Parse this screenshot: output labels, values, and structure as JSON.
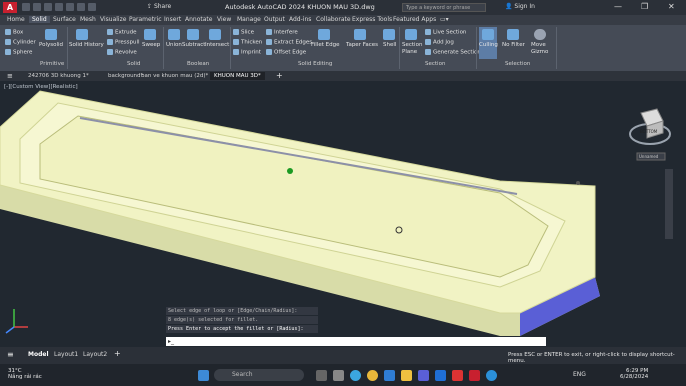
{
  "title_bar": {
    "app_title": "Autodesk AutoCAD 2024   KHUON MAU 3D.dwg",
    "share_label": "Share",
    "search_placeholder": "Type a keyword or phrase",
    "signin_label": "Sign In",
    "logo_letter": "A"
  },
  "ribbon_tabs": [
    "Home",
    "Solid",
    "Surface",
    "Mesh",
    "Visualize",
    "Parametric",
    "Insert",
    "Annotate",
    "View",
    "Manage",
    "Output",
    "Add-ins",
    "Collaborate",
    "Express Tools",
    "Featured Apps"
  ],
  "active_tab": "Solid",
  "ribbon": {
    "primitive": {
      "box": "Box",
      "cylinder": "Cylinder",
      "sphere": "Sphere",
      "polysolid": "Polysolid",
      "label": "Primitive"
    },
    "solid": {
      "solid_history": "Solid History",
      "extrude": "Extrude",
      "presspull": "Presspull",
      "revolve": "Revolve",
      "sweep": "Sweep",
      "label": "Solid"
    },
    "boolean": {
      "union": "Union",
      "subtract": "Subtract",
      "intersect": "Intersect",
      "label": "Boolean"
    },
    "solid_editing": {
      "slice": "Slice",
      "thicken": "Thicken",
      "imprint": "Imprint",
      "interfere": "Interfere",
      "extract_edges": "Extract Edges",
      "offset_edge": "Offset Edge",
      "fillet_edge": "Fillet Edge",
      "taper_faces": "Taper Faces",
      "shell": "Shell",
      "label": "Solid Editing"
    },
    "section": {
      "section_plane": "Section Plane",
      "live_section": "Live Section",
      "add_jog": "Add Jog",
      "generate_section": "Generate Section",
      "label": "Section"
    },
    "selection": {
      "culling": "Culling",
      "no_filter": "No Filter",
      "move_gizmo": "Move Gizmo",
      "label": "Selection"
    }
  },
  "file_tabs": [
    "242706 3D khuong 1*",
    "background*",
    "ban ve khuon mau (2d)*",
    "KHUON MAU 3D*"
  ],
  "active_file": "KHUON MAU 3D*",
  "viewport": {
    "label": "[-][Custom View][Realistic]",
    "viewcube_label": "BOTTOM",
    "ucs_label": "Unnamed"
  },
  "command_history": [
    "Select edge of loop or [Edge/Chain/Radius]:",
    "8 edge(s) selected for fillet.",
    "Press Enter to accept the fillet or [Radius]:"
  ],
  "command_prompt_placeholder": "",
  "layout_tabs": [
    "Model",
    "Layout1",
    "Layout2"
  ],
  "status_message": "Press ESC or ENTER to exit, or right-click to display shortcut-menu.",
  "taskbar": {
    "weather_temp": "31°C",
    "weather_desc": "Nắng rải rác",
    "search_placeholder": "Search",
    "time": "6:29 PM",
    "date": "6/28/2024",
    "lang": "ENG"
  },
  "colors": {
    "model_face": "#f1f3c4",
    "model_side": "#5a5fd6",
    "accent_logo": "#c8202f"
  }
}
